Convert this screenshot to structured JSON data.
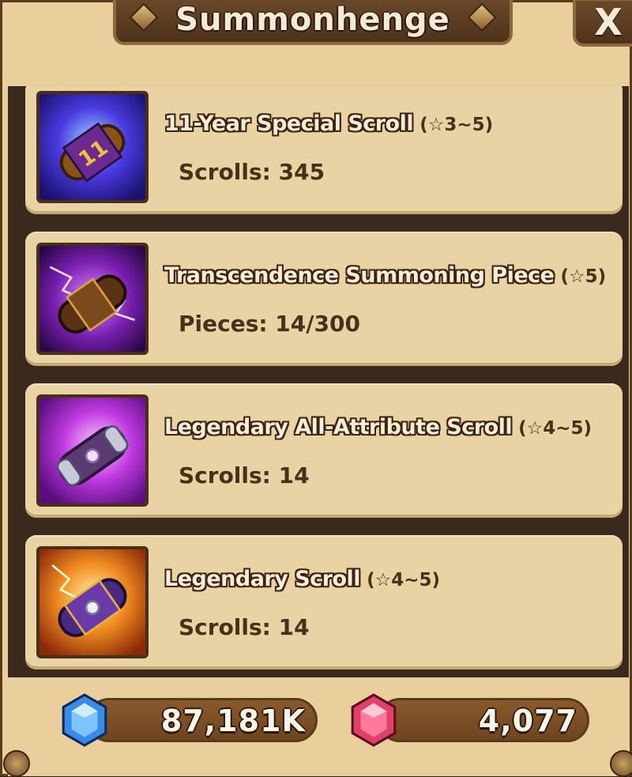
{
  "window": {
    "title": "Summonhenge",
    "close_label": "X"
  },
  "items": [
    {
      "name": "11-Year Special Scroll",
      "grade": "(☆3~5)",
      "count": "Scrolls: 345",
      "icon": "special-scroll-icon",
      "icon_bg": "#3a2ad8"
    },
    {
      "name": "Transcendence Summoning Piece",
      "grade": "(☆5)",
      "count": "Pieces: 14/300",
      "icon": "transcendence-piece-icon",
      "icon_bg": "#7a1fb0"
    },
    {
      "name": "Legendary All-Attribute Scroll",
      "grade": "(☆4~5)",
      "count": "Scrolls: 14",
      "icon": "all-attribute-scroll-icon",
      "icon_bg": "#b02ad0"
    },
    {
      "name": "Legendary Scroll",
      "grade": "(☆4~5)",
      "count": "Scrolls: 14",
      "icon": "legendary-scroll-icon",
      "icon_bg": "#e0701a"
    }
  ],
  "currency": {
    "crystals": {
      "value": "87,181K",
      "icon": "blue-crystal-icon",
      "color": "#3a8ae8"
    },
    "gems": {
      "value": "4,077",
      "icon": "pink-gem-icon",
      "color": "#e0406a"
    }
  }
}
